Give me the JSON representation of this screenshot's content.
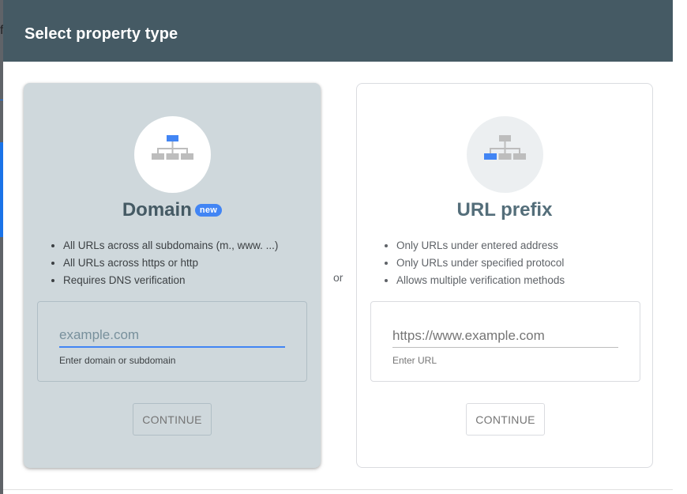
{
  "background": {
    "peek_letter": "f"
  },
  "dialog": {
    "title": "Select property type",
    "separator": "or"
  },
  "cards": {
    "domain": {
      "icon": "sitemap-icon",
      "title": "Domain",
      "badge": "new",
      "features": [
        "All URLs across all subdomains (m., www. ...)",
        "All URLs across https or http",
        "Requires DNS verification"
      ],
      "input_placeholder": "example.com",
      "input_value": "",
      "helper": "Enter domain or subdomain",
      "continue_label": "CONTINUE"
    },
    "url_prefix": {
      "icon": "sitemap-icon",
      "title": "URL prefix",
      "features": [
        "Only URLs under entered address",
        "Only URLs under specified protocol",
        "Allows multiple verification methods"
      ],
      "input_placeholder": "https://www.example.com",
      "input_value": "",
      "helper": "Enter URL",
      "continue_label": "CONTINUE"
    }
  },
  "colors": {
    "header": "#455a64",
    "selected_card": "#cfd8dc",
    "accent": "#4285f4"
  }
}
